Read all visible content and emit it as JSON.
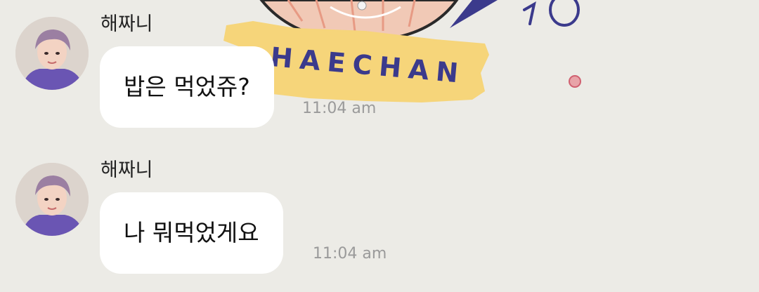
{
  "wallpaper": {
    "text": "HAECHAN"
  },
  "messages": [
    {
      "sender": "해짜니",
      "text": "밥은 먹었쥬?",
      "time": "11:04 am"
    },
    {
      "sender": "해짜니",
      "text": "나 뭐먹었게요",
      "time": "11:04 am"
    }
  ],
  "colors": {
    "background": "#ecebe6",
    "bubble": "#ffffff",
    "wallpaper_banner": "#f6d57a",
    "wallpaper_ink": "#3b3a8c"
  }
}
